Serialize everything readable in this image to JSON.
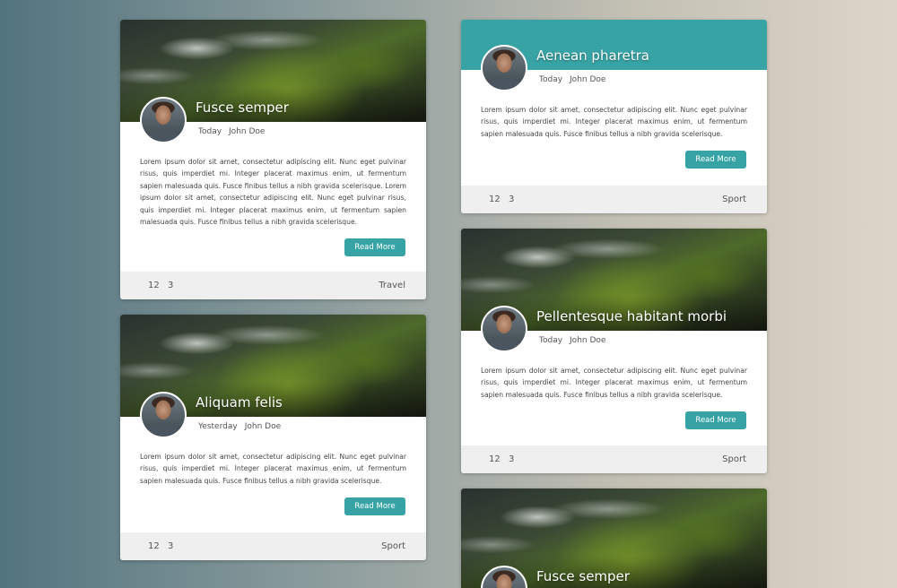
{
  "colors": {
    "accent": "#38a3a5",
    "footer_bg": "#efefef",
    "card_bg": "#ffffff"
  },
  "lorem_short": "Lorem ipsum dolor sit amet, consectetur adipiscing elit. Nunc eget pulvinar risus, quis imperdiet mi. Integer placerat maximus enim, ut fermentum sapien malesuada quis. Fusce finibus tellus a nibh gravida scelerisque.",
  "lorem_long": "Lorem ipsum dolor sit amet, consectetur adipiscing elit. Nunc eget pulvinar risus, quis imperdiet mi. Integer placerat maximus enim, ut fermentum sapien malesuada quis. Fusce finibus tellus a nibh gravida scelerisque. Lorem ipsum dolor sit amet, consectetur adipiscing elit. Nunc eget pulvinar risus, quis imperdiet mi. Integer placerat maximus enim, ut fermentum sapien malesuada quis. Fusce finibus tellus a nibh gravida scelerisque.",
  "cards": [
    {
      "title": "Fusce semper",
      "date": "Today",
      "author": "John Doe",
      "button": "Read More",
      "stat1": "12",
      "stat2": "3",
      "category": "Travel",
      "header": "image"
    },
    {
      "title": "Aliquam felis",
      "date": "Yesterday",
      "author": "John Doe",
      "button": "Read More",
      "stat1": "12",
      "stat2": "3",
      "category": "Sport",
      "header": "image"
    },
    {
      "title": "Aenean pharetra",
      "date": "Today",
      "author": "John Doe",
      "button": "Read More",
      "stat1": "12",
      "stat2": "3",
      "category": "Sport",
      "header": "teal"
    },
    {
      "title": "Pellentesque habitant morbi",
      "date": "Today",
      "author": "John Doe",
      "button": "Read More",
      "stat1": "12",
      "stat2": "3",
      "category": "Sport",
      "header": "image"
    },
    {
      "title": "Fusce semper",
      "header": "image"
    }
  ]
}
